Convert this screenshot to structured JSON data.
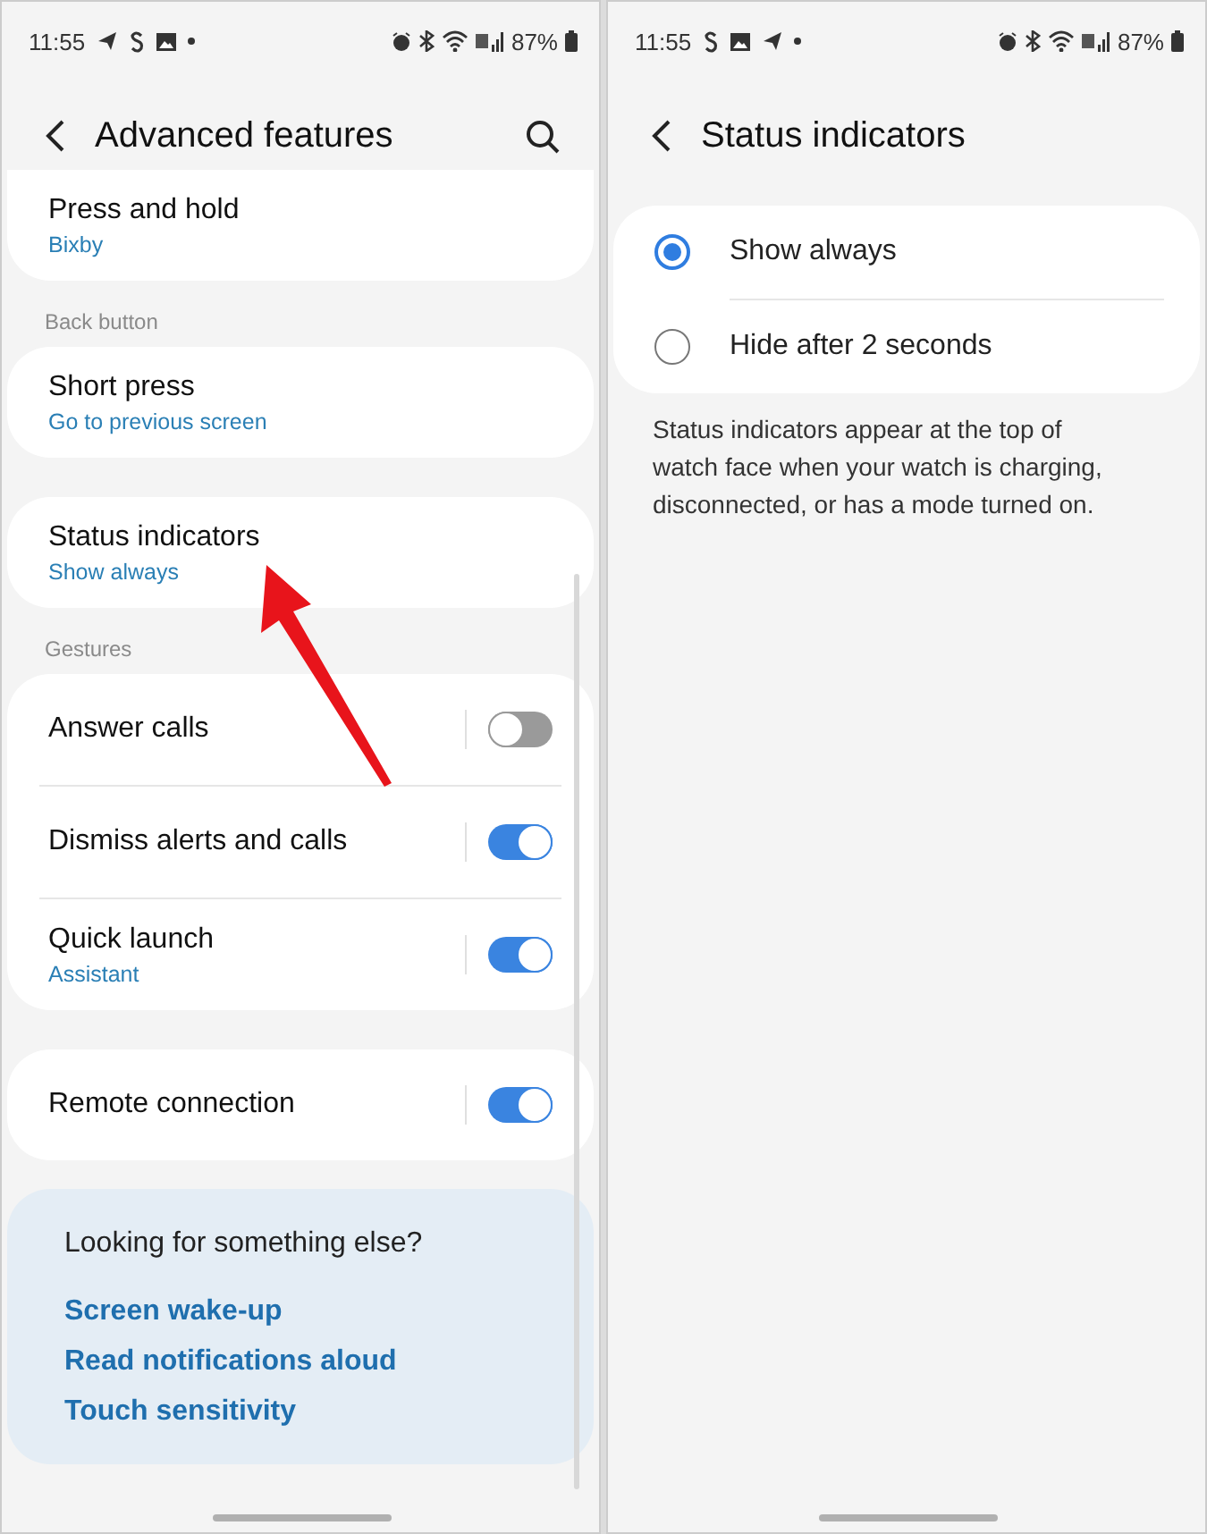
{
  "screens": [
    {
      "status_bar": {
        "time": "11:55",
        "battery": "87%",
        "notifications": [
          {
            "kind": "send"
          },
          {
            "kind": "dollar"
          },
          {
            "kind": "image"
          },
          {
            "kind": "dot"
          }
        ]
      },
      "header": {
        "title": "Advanced features",
        "search": true
      },
      "sections": [
        {
          "items": [
            {
              "kind": "link",
              "title": "Press and hold",
              "subtitle": "Bixby"
            }
          ]
        },
        {
          "label": "Back button",
          "items": [
            {
              "kind": "link",
              "title": "Short press",
              "subtitle": "Go to previous screen"
            }
          ]
        },
        {
          "items": [
            {
              "kind": "link",
              "title": "Status indicators",
              "subtitle": "Show always"
            }
          ]
        },
        {
          "label": "Gestures",
          "items": [
            {
              "kind": "switch",
              "title": "Answer calls",
              "on": false
            },
            {
              "kind": "switch",
              "title": "Dismiss alerts and calls",
              "on": true
            },
            {
              "kind": "switch",
              "title": "Quick launch",
              "subtitle": "Assistant",
              "on": true
            }
          ]
        },
        {
          "items": [
            {
              "kind": "switch",
              "title": "Remote connection",
              "on": true
            }
          ]
        }
      ],
      "suggestions": {
        "title": "Looking for something else?",
        "links": [
          "Screen wake-up",
          "Read notifications aloud",
          "Touch sensitivity"
        ]
      }
    },
    {
      "status_bar": {
        "time": "11:55",
        "battery": "87%",
        "notifications": [
          {
            "kind": "dollar"
          },
          {
            "kind": "image"
          },
          {
            "kind": "send"
          },
          {
            "kind": "dot"
          }
        ]
      },
      "header": {
        "title": "Status indicators",
        "search": false
      },
      "options": [
        {
          "label": "Show always",
          "selected": true
        },
        {
          "label": "Hide after 2 seconds",
          "selected": false
        }
      ],
      "description": "Status indicators appear at the top of watch face when your watch is charging, disconnected, or has a mode turned on."
    }
  ]
}
